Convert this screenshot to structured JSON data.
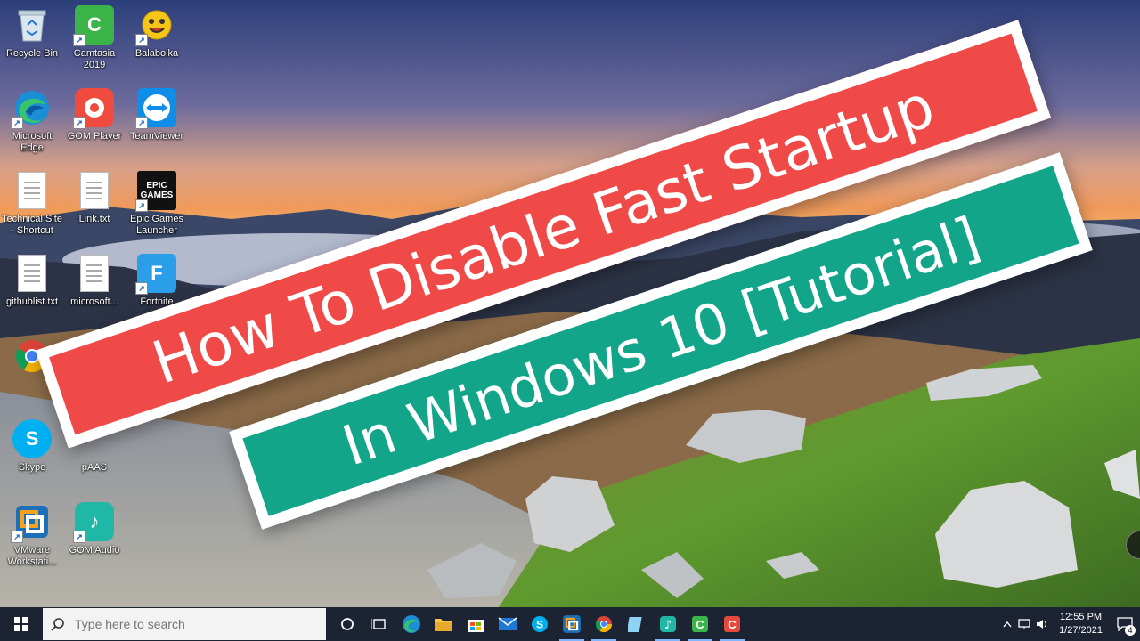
{
  "desktop": {
    "icons": [
      {
        "label": "Recycle Bin"
      },
      {
        "label": "Camtasia 2019"
      },
      {
        "label": "Balabolka"
      },
      {
        "label": "Microsoft Edge"
      },
      {
        "label": "GOM Player"
      },
      {
        "label": "TeamViewer"
      },
      {
        "label": "Technical Site - Shortcut"
      },
      {
        "label": "Link.txt"
      },
      {
        "label": "Epic Games Launcher"
      },
      {
        "label": "githublist.txt"
      },
      {
        "label": "microsoft..."
      },
      {
        "label": "Fortnite"
      },
      {
        "label": "Skype"
      },
      {
        "label": "pAAS"
      },
      {
        "label": "VMware Workstati..."
      },
      {
        "label": "GOM Audio"
      }
    ],
    "epic_logo_text": "EPIC\nGAMES"
  },
  "banner": {
    "line1": "How To Disable Fast Startup",
    "line2": "In Windows 10 [Tutorial]",
    "line1_color": "#ef4a48",
    "line2_color": "#13a58a"
  },
  "taskbar": {
    "search_placeholder": "Type here to search",
    "apps": [
      "task-view",
      "edge",
      "file-explorer",
      "store",
      "mail",
      "skype",
      "vmware",
      "chrome",
      "notepad",
      "gom-audio",
      "camtasia",
      "camtasia-recorder"
    ],
    "clock_time": "12:55 PM",
    "clock_date": "1/27/2021",
    "notification_count": "4"
  }
}
